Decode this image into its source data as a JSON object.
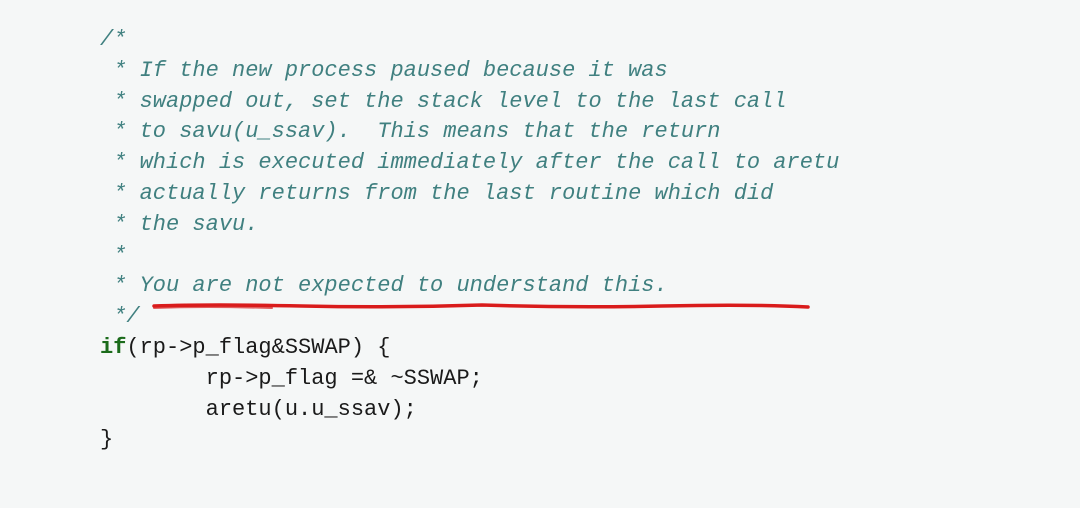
{
  "code": {
    "comment_open": "/*",
    "comment_lines": [
      " * If the new process paused because it was",
      " * swapped out, set the stack level to the last call",
      " * to savu(u_ssav).  This means that the return",
      " * which is executed immediately after the call to aretu",
      " * actually returns from the last routine which did",
      " * the savu.",
      " *",
      " * You are not expected to understand this.",
      " */"
    ],
    "if_keyword": "if",
    "if_condition": "(rp->p_flag&SSWAP) {",
    "body_line1": "        rp->p_flag =& ~SSWAP;",
    "body_line2": "        aretu(u.u_ssav);",
    "close_brace": "}"
  },
  "annotation": {
    "underline_color": "#d91c1c"
  }
}
